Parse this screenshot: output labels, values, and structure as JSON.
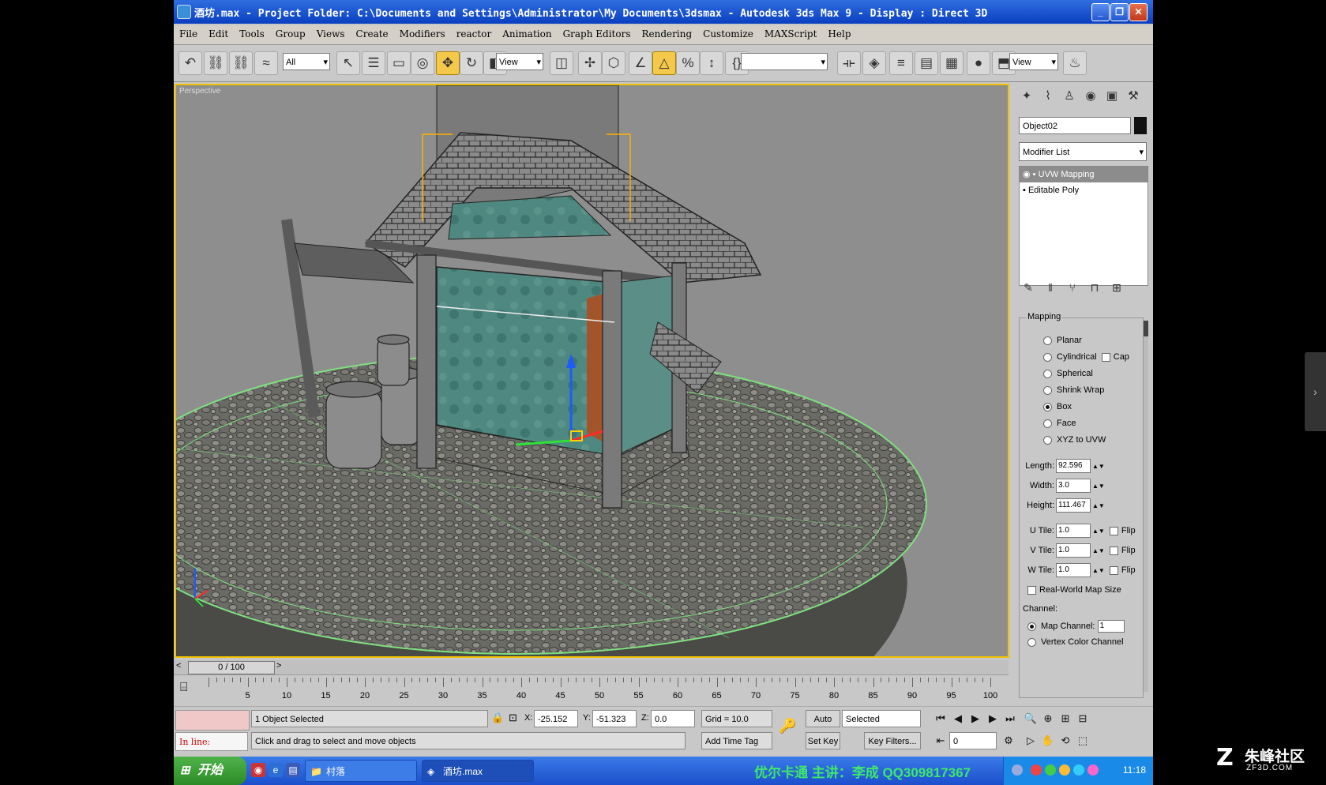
{
  "window": {
    "title": "酒坊.max    - Project Folder: C:\\Documents and Settings\\Administrator\\My Documents\\3dsmax    - Autodesk 3ds Max 9    - Display : Direct 3D",
    "minimize": "_",
    "maximize": "❐",
    "close": "✕"
  },
  "menu": [
    "File",
    "Edit",
    "Tools",
    "Group",
    "Views",
    "Create",
    "Modifiers",
    "reactor",
    "Animation",
    "Graph Editors",
    "Rendering",
    "Customize",
    "MAXScript",
    "Help"
  ],
  "toolbar": {
    "selection_filter": "All",
    "ref_coord": "View",
    "named_selection": "",
    "render_type": "View"
  },
  "viewport": {
    "label": "Perspective"
  },
  "command_panel": {
    "object_name": "Object02",
    "modifier_list": "Modifier List",
    "stack": [
      "UVW Mapping",
      "Editable Poly"
    ],
    "mapping": {
      "title": "Mapping",
      "options": [
        "Planar",
        "Cylindrical",
        "Spherical",
        "Shrink Wrap",
        "Box",
        "Face",
        "XYZ to UVW"
      ],
      "selected": "Box",
      "cap_label": "Cap",
      "length_label": "Length:",
      "length_value": "92.596",
      "width_label": "Width:",
      "width_value": "3.0",
      "height_label": "Height:",
      "height_value": "111.467",
      "utile_label": "U Tile:",
      "utile_value": "1.0",
      "vtile_label": "V Tile:",
      "vtile_value": "1.0",
      "wtile_label": "W Tile:",
      "wtile_value": "1.0",
      "flip_label": "Flip",
      "realworld_label": "Real-World Map Size"
    },
    "channel": {
      "title": "Channel:",
      "map_channel_label": "Map Channel:",
      "map_channel_value": "1",
      "vertex_color_label": "Vertex Color Channel"
    }
  },
  "time_slider": {
    "frame": "0 / 100",
    "prev": "<",
    "next": ">"
  },
  "trackbar": {
    "labels": [
      "5",
      "10",
      "15",
      "20",
      "25",
      "30",
      "35",
      "40",
      "45",
      "50",
      "55",
      "60",
      "65",
      "70",
      "75",
      "80",
      "85",
      "90",
      "95",
      "100"
    ]
  },
  "status": {
    "selection": "1 Object Selected",
    "prompt": "Click and drag to select and move objects",
    "listener": "In line:",
    "x_label": "X:",
    "x_value": "-25.152",
    "y_label": "Y:",
    "y_value": "-51.323",
    "z_label": "Z:",
    "z_value": "0.0",
    "grid": "Grid = 10.0",
    "add_time_tag": "Add Time Tag",
    "auto_key": "Auto Key",
    "set_key": "Set Key",
    "key_mode": "Selected",
    "key_filters": "Key Filters...",
    "current_frame": "0"
  },
  "taskbar": {
    "start": "开始",
    "tasks": [
      {
        "label": "村落"
      },
      {
        "label": "酒坊.max"
      }
    ],
    "banner": "优尔卡通 主讲：李成 QQ309817367",
    "clock": "11:18"
  },
  "watermark": {
    "cn": "朱峰社区",
    "en": "ZF3D.COM"
  },
  "colors": {
    "accent": "#f2c200",
    "titlebar": "#1a56d6",
    "taskbar": "#2a63dc",
    "banner": "#3ee86a"
  }
}
